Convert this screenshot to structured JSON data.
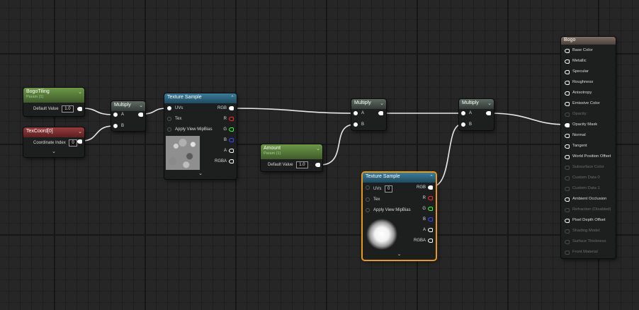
{
  "nodes": {
    "bogo_tiling": {
      "title": "BogoTiling",
      "subtitle": "Param (1)",
      "row_label": "Default Value",
      "value": "1.0"
    },
    "texcoord": {
      "title": "TexCoord[0]",
      "row_label": "Coordinate Index",
      "value": "0"
    },
    "multiply1": {
      "title": "Multiply",
      "pin_a": "A",
      "pin_b": "B"
    },
    "texture_sample1": {
      "title": "Texture Sample",
      "uvs": "UVs",
      "tex": "Tex",
      "mip": "Apply View MipBias",
      "out_rgb": "RGB",
      "out_r": "R",
      "out_g": "G",
      "out_b": "B",
      "out_a": "A",
      "out_rgba": "RGBA"
    },
    "amount": {
      "title": "Amount",
      "subtitle": "Param (1)",
      "row_label": "Default Value",
      "value": "1.0"
    },
    "multiply2": {
      "title": "Multiply",
      "pin_a": "A",
      "pin_b": "B"
    },
    "texture_sample2": {
      "title": "Texture Sample",
      "uvs": "UVs",
      "uvs_value": "0",
      "tex": "Tex",
      "mip": "Apply View MipBias",
      "out_rgb": "RGB",
      "out_r": "R",
      "out_g": "G",
      "out_b": "B",
      "out_a": "A",
      "out_rgba": "RGBA"
    },
    "multiply3": {
      "title": "Multiply",
      "pin_a": "A",
      "pin_b": "B"
    },
    "material": {
      "title": "Bogo",
      "inputs": [
        {
          "label": "Base Color",
          "enabled": true
        },
        {
          "label": "Metallic",
          "enabled": true
        },
        {
          "label": "Specular",
          "enabled": true
        },
        {
          "label": "Roughness",
          "enabled": true
        },
        {
          "label": "Anisotropy",
          "enabled": true
        },
        {
          "label": "Emissive Color",
          "enabled": true
        },
        {
          "label": "Opacity",
          "enabled": false
        },
        {
          "label": "Opacity Mask",
          "enabled": true
        },
        {
          "label": "Normal",
          "enabled": true
        },
        {
          "label": "Tangent",
          "enabled": true
        },
        {
          "label": "World Position Offset",
          "enabled": true
        },
        {
          "label": "Subsurface Color",
          "enabled": false
        },
        {
          "label": "Custom Data 0",
          "enabled": false
        },
        {
          "label": "Custom Data 1",
          "enabled": false
        },
        {
          "label": "Ambient Occlusion",
          "enabled": true
        },
        {
          "label": "Refraction (Disabled)",
          "enabled": false
        },
        {
          "label": "Pixel Depth Offset",
          "enabled": true
        },
        {
          "label": "Shading Model",
          "enabled": false
        },
        {
          "label": "Surface Thickness",
          "enabled": false
        },
        {
          "label": "Front Material",
          "enabled": false
        }
      ]
    }
  },
  "icons": {
    "expand": "chevron-down-icon",
    "collapse": "chevron-icon"
  },
  "colors": {
    "param_header": "#5e8a3c",
    "texcoord_header": "#8b3535",
    "math_header": "#4e5a54",
    "texture_header": "#2f6e8c",
    "material_header": "#6e6158",
    "selection": "#e59a1a",
    "pin_r": "#ff2a2a",
    "pin_g": "#33ff33",
    "pin_b": "#3344ff"
  }
}
